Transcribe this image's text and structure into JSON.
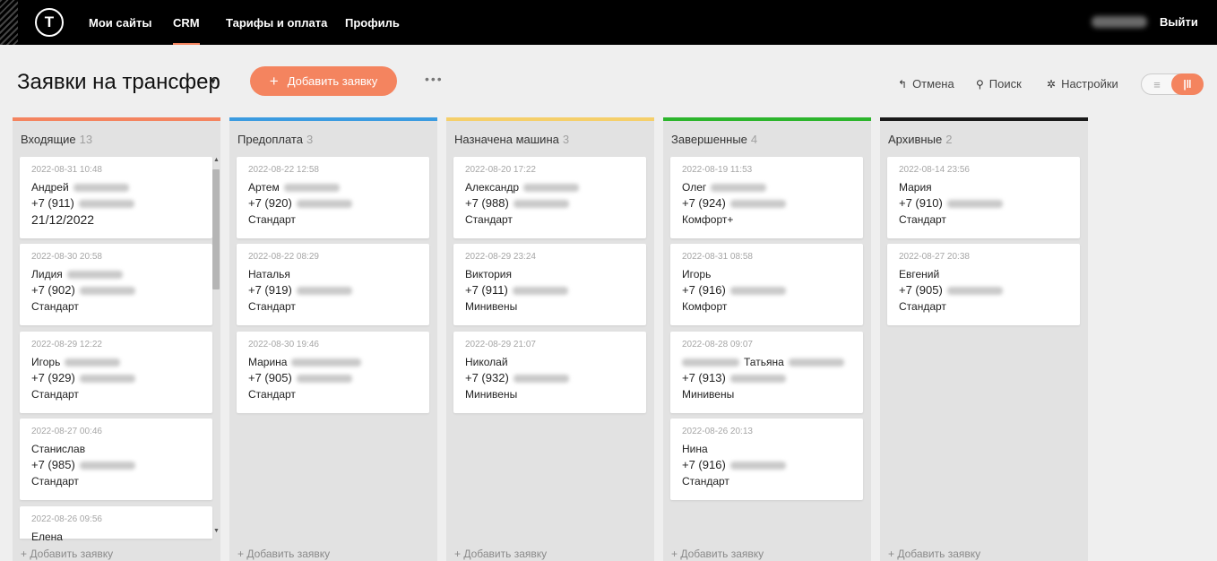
{
  "topbar": {
    "logo": "T",
    "nav": [
      "Мои сайты",
      "CRM",
      "Тарифы и оплата",
      "Профиль"
    ],
    "active_nav": "CRM",
    "logout": "Выйти"
  },
  "header": {
    "title": "Заявки на трансфер",
    "caret": "▾",
    "add_button": "Добавить заявку",
    "add_plus": "+",
    "more": "•••",
    "undo": "Отмена",
    "undo_icon": "↰",
    "search": "Поиск",
    "search_icon": "⚲",
    "settings": "Настройки",
    "settings_icon": "✲",
    "view_list_icon": "≡",
    "view_board_icon": "|‖"
  },
  "colors": {
    "accent": "#f4845f",
    "col_incoming": "#f4845f",
    "col_prepaid": "#3b9be0",
    "col_assigned": "#f5cf6a",
    "col_done": "#2cb52c",
    "col_archive": "#1a1a1a"
  },
  "board": {
    "add_request": "+ Добавить заявку",
    "columns": [
      {
        "title": "Входящие",
        "count": "13",
        "cards": [
          {
            "date": "2022-08-31 10:48",
            "name": "Андрей",
            "phone": "+7 (911)",
            "tariff": "21/12/2022"
          },
          {
            "date": "2022-08-30 20:58",
            "name": "Лидия",
            "phone": "+7 (902)",
            "tariff": "Стандарт"
          },
          {
            "date": "2022-08-29 12:22",
            "name": "Игорь",
            "phone": "+7 (929)",
            "tariff": "Стандарт"
          },
          {
            "date": "2022-08-27 00:46",
            "name": "Станислав",
            "phone": "+7 (985)",
            "tariff": "Стандарт"
          },
          {
            "date": "2022-08-26 09:56",
            "name": "Елена"
          }
        ]
      },
      {
        "title": "Предоплата",
        "count": "3",
        "cards": [
          {
            "date": "2022-08-22 12:58",
            "name": "Артем",
            "phone": "+7 (920)",
            "tariff": "Стандарт"
          },
          {
            "date": "2022-08-22 08:29",
            "name": "Наталья",
            "phone": "+7 (919)",
            "tariff": "Стандарт"
          },
          {
            "date": "2022-08-30 19:46",
            "name": "Марина",
            "phone": "+7 (905)",
            "tariff": "Стандарт"
          }
        ]
      },
      {
        "title": "Назначена машина",
        "count": "3",
        "cards": [
          {
            "date": "2022-08-20 17:22",
            "name": "Александр",
            "phone": "+7 (988)",
            "tariff": "Стандарт"
          },
          {
            "date": "2022-08-29 23:24",
            "name": "Виктория",
            "phone": "+7 (911)",
            "tariff": "Минивены"
          },
          {
            "date": "2022-08-29 21:07",
            "name": "Николай",
            "phone": "+7 (932)",
            "tariff": "Минивены"
          }
        ]
      },
      {
        "title": "Завершенные",
        "count": "4",
        "cards": [
          {
            "date": "2022-08-19 11:53",
            "name": "Олег",
            "phone": "+7 (924)",
            "tariff": "Комфорт+"
          },
          {
            "date": "2022-08-31 08:58",
            "name": "Игорь",
            "phone": "+7 (916)",
            "tariff": "Комфорт"
          },
          {
            "date": "2022-08-28 09:07",
            "name": "Татьяна",
            "phone": "+7 (913)",
            "tariff": "Минивены"
          },
          {
            "date": "2022-08-26 20:13",
            "name": "Нина",
            "phone": "+7 (916)",
            "tariff": "Стандарт"
          }
        ]
      },
      {
        "title": "Архивные",
        "count": "2",
        "cards": [
          {
            "date": "2022-08-14 23:56",
            "name": "Мария",
            "phone": "+7 (910)",
            "tariff": "Стандарт"
          },
          {
            "date": "2022-08-27 20:38",
            "name": "Евгений",
            "phone": "+7 (905)",
            "tariff": "Стандарт"
          }
        ]
      }
    ]
  }
}
